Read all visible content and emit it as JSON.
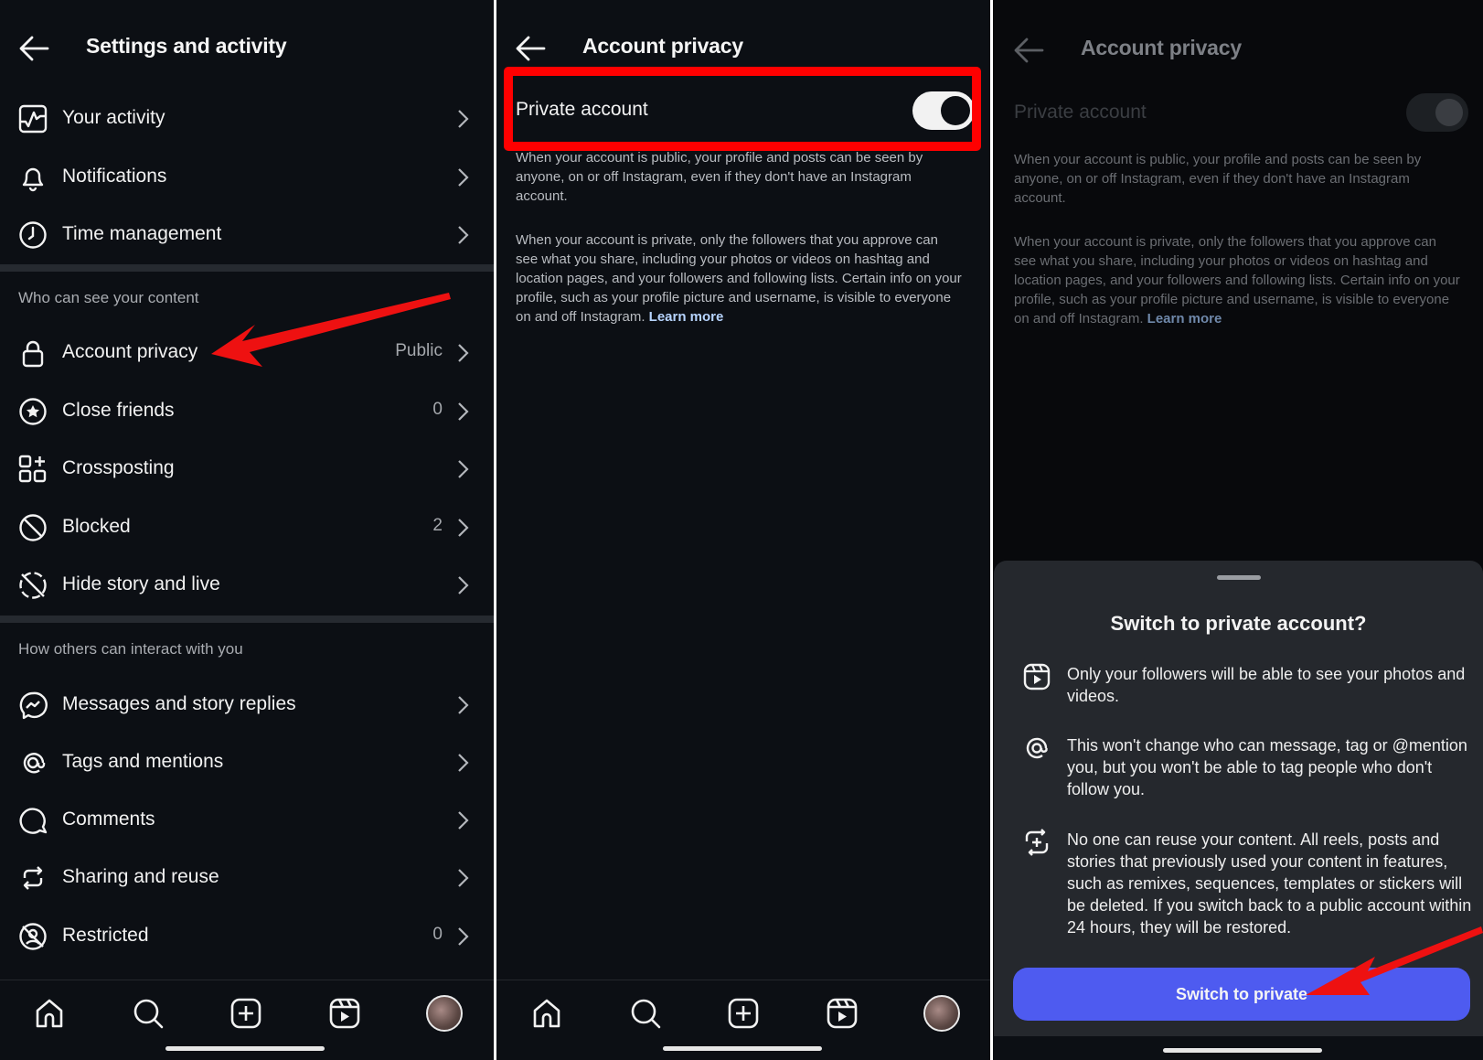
{
  "panel1": {
    "title": "Settings and activity",
    "top_items": [
      {
        "label": "Your activity",
        "icon": "activity-icon",
        "value": ""
      },
      {
        "label": "Notifications",
        "icon": "bell-icon",
        "value": ""
      },
      {
        "label": "Time management",
        "icon": "clock-icon",
        "value": ""
      }
    ],
    "section1_title": "Who can see your content",
    "section1_items": [
      {
        "label": "Account privacy",
        "icon": "lock-icon",
        "value": "Public"
      },
      {
        "label": "Close friends",
        "icon": "star-circle-icon",
        "value": "0"
      },
      {
        "label": "Crossposting",
        "icon": "crossposting-icon",
        "value": ""
      },
      {
        "label": "Blocked",
        "icon": "blocked-icon",
        "value": "2"
      },
      {
        "label": "Hide story and live",
        "icon": "hide-story-icon",
        "value": ""
      }
    ],
    "section2_title": "How others can interact with you",
    "section2_items": [
      {
        "label": "Messages and story replies",
        "icon": "messenger-icon",
        "value": ""
      },
      {
        "label": "Tags and mentions",
        "icon": "at-sign-icon",
        "value": ""
      },
      {
        "label": "Comments",
        "icon": "comment-icon",
        "value": ""
      },
      {
        "label": "Sharing and reuse",
        "icon": "share-reuse-icon",
        "value": ""
      },
      {
        "label": "Restricted",
        "icon": "restricted-icon",
        "value": "0"
      }
    ]
  },
  "panel2": {
    "title": "Account privacy",
    "toggle_label": "Private account",
    "toggle_on": true,
    "public_text": "When your account is public, your profile and posts can be seen by anyone, on or off Instagram, even if they don't have an Instagram account.",
    "private_text": "When your account is private, only the followers that you approve can see what you share, including your photos or videos on hashtag and location pages, and your followers and following lists. Certain info on your profile, such as your profile picture and username, is visible to everyone on and off Instagram.",
    "learn_more": "Learn more"
  },
  "panel3": {
    "title": "Account privacy",
    "toggle_label": "Private account",
    "public_text": "When your account is public, your profile and posts can be seen by anyone, on or off Instagram, even if they don't have an Instagram account.",
    "private_text": "When your account is private, only the followers that you approve can see what you share, including your photos or videos on hashtag and location pages, and your followers and following lists. Certain info on your profile, such as your profile picture and username, is visible to everyone on and off Instagram.",
    "learn_more": "Learn more",
    "sheet": {
      "title": "Switch to private account?",
      "bullets": [
        {
          "icon": "reels-icon",
          "text": "Only your followers will be able to see your photos and videos."
        },
        {
          "icon": "at-sign-icon",
          "text": "This won't change who can message, tag or @mention you, but you won't be able to tag people who don't follow you."
        },
        {
          "icon": "remix-icon",
          "text": "No one can reuse your content. All reels, posts and stories that previously used your content in features, such as remixes, sequences, templates or stickers will be deleted. If you switch back to a public account within 24 hours, they will be restored."
        }
      ],
      "button_label": "Switch to private"
    }
  },
  "nav": [
    "home-icon",
    "search-icon",
    "create-icon",
    "reels-icon",
    "profile-avatar"
  ],
  "colors": {
    "background": "#0c0f14",
    "sheet": "#25282d",
    "primary_button": "#4e5bf0",
    "link": "#b7d4ff",
    "annotation": "#ff0000"
  }
}
